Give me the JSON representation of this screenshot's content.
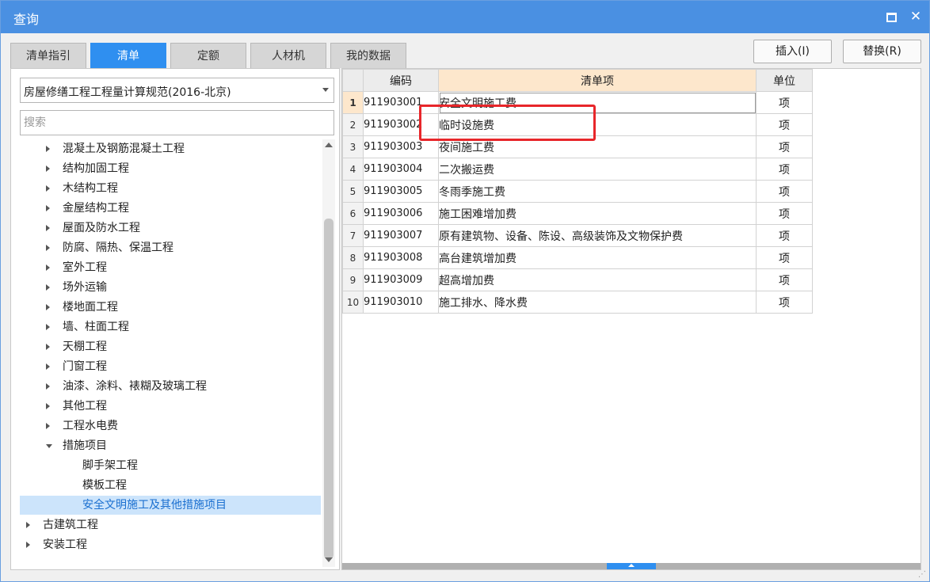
{
  "window": {
    "title": "查询",
    "maximize_icon": "maximize-icon",
    "close_icon": "close-icon",
    "close_glyph": "✕"
  },
  "tabs": [
    {
      "label": "清单指引",
      "active": false
    },
    {
      "label": "清单",
      "active": true
    },
    {
      "label": "定额",
      "active": false
    },
    {
      "label": "人材机",
      "active": false
    },
    {
      "label": "我的数据",
      "active": false
    }
  ],
  "actions": {
    "insert": "插入(I)",
    "replace": "替换(R)"
  },
  "spec_select": {
    "value": "房屋修缮工程工程量计算规范(2016-北京)"
  },
  "search": {
    "placeholder": "搜索",
    "value": ""
  },
  "tree": [
    {
      "label": "混凝土及钢筋混凝土工程",
      "level": 1,
      "state": "collapsed"
    },
    {
      "label": "结构加固工程",
      "level": 1,
      "state": "collapsed"
    },
    {
      "label": "木结构工程",
      "level": 1,
      "state": "collapsed"
    },
    {
      "label": "金屋结构工程",
      "level": 1,
      "state": "collapsed"
    },
    {
      "label": "屋面及防水工程",
      "level": 1,
      "state": "collapsed"
    },
    {
      "label": "防腐、隔热、保温工程",
      "level": 1,
      "state": "collapsed"
    },
    {
      "label": "室外工程",
      "level": 1,
      "state": "collapsed"
    },
    {
      "label": "场外运输",
      "level": 1,
      "state": "collapsed"
    },
    {
      "label": "楼地面工程",
      "level": 1,
      "state": "collapsed"
    },
    {
      "label": "墙、柱面工程",
      "level": 1,
      "state": "collapsed"
    },
    {
      "label": "天棚工程",
      "level": 1,
      "state": "collapsed"
    },
    {
      "label": "门窗工程",
      "level": 1,
      "state": "collapsed"
    },
    {
      "label": "油漆、涂料、裱糊及玻璃工程",
      "level": 1,
      "state": "collapsed"
    },
    {
      "label": "其他工程",
      "level": 1,
      "state": "collapsed"
    },
    {
      "label": "工程水电费",
      "level": 1,
      "state": "collapsed"
    },
    {
      "label": "措施项目",
      "level": 1,
      "state": "expanded"
    },
    {
      "label": "脚手架工程",
      "level": 2,
      "state": "leaf"
    },
    {
      "label": "模板工程",
      "level": 2,
      "state": "leaf"
    },
    {
      "label": "安全文明施工及其他措施项目",
      "level": 2,
      "state": "leaf",
      "selected": true
    },
    {
      "label": "古建筑工程",
      "level": 0,
      "state": "collapsed"
    },
    {
      "label": "安装工程",
      "level": 0,
      "state": "collapsed"
    }
  ],
  "grid": {
    "headers": {
      "code": "编码",
      "item": "清单项",
      "unit": "单位"
    },
    "rows": [
      {
        "no": "1",
        "code": "911903001",
        "item": "安全文明施工费",
        "unit": "项"
      },
      {
        "no": "2",
        "code": "911903002",
        "item": "临时设施费",
        "unit": "项"
      },
      {
        "no": "3",
        "code": "911903003",
        "item": "夜间施工费",
        "unit": "项"
      },
      {
        "no": "4",
        "code": "911903004",
        "item": "二次搬运费",
        "unit": "项"
      },
      {
        "no": "5",
        "code": "911903005",
        "item": "冬雨季施工费",
        "unit": "项"
      },
      {
        "no": "6",
        "code": "911903006",
        "item": "施工困难增加费",
        "unit": "项"
      },
      {
        "no": "7",
        "code": "911903007",
        "item": "原有建筑物、设备、陈设、高级装饰及文物保护费",
        "unit": "项"
      },
      {
        "no": "8",
        "code": "911903008",
        "item": "高台建筑增加费",
        "unit": "项"
      },
      {
        "no": "9",
        "code": "911903009",
        "item": "超高增加费",
        "unit": "项"
      },
      {
        "no": "10",
        "code": "911903010",
        "item": "施工排水、降水费",
        "unit": "项"
      }
    ]
  },
  "colors": {
    "titlebar": "#4a90e2",
    "tab_active": "#2f8ff0",
    "highlight_box": "#e8262a",
    "tree_selected_bg": "#cce4fb"
  }
}
